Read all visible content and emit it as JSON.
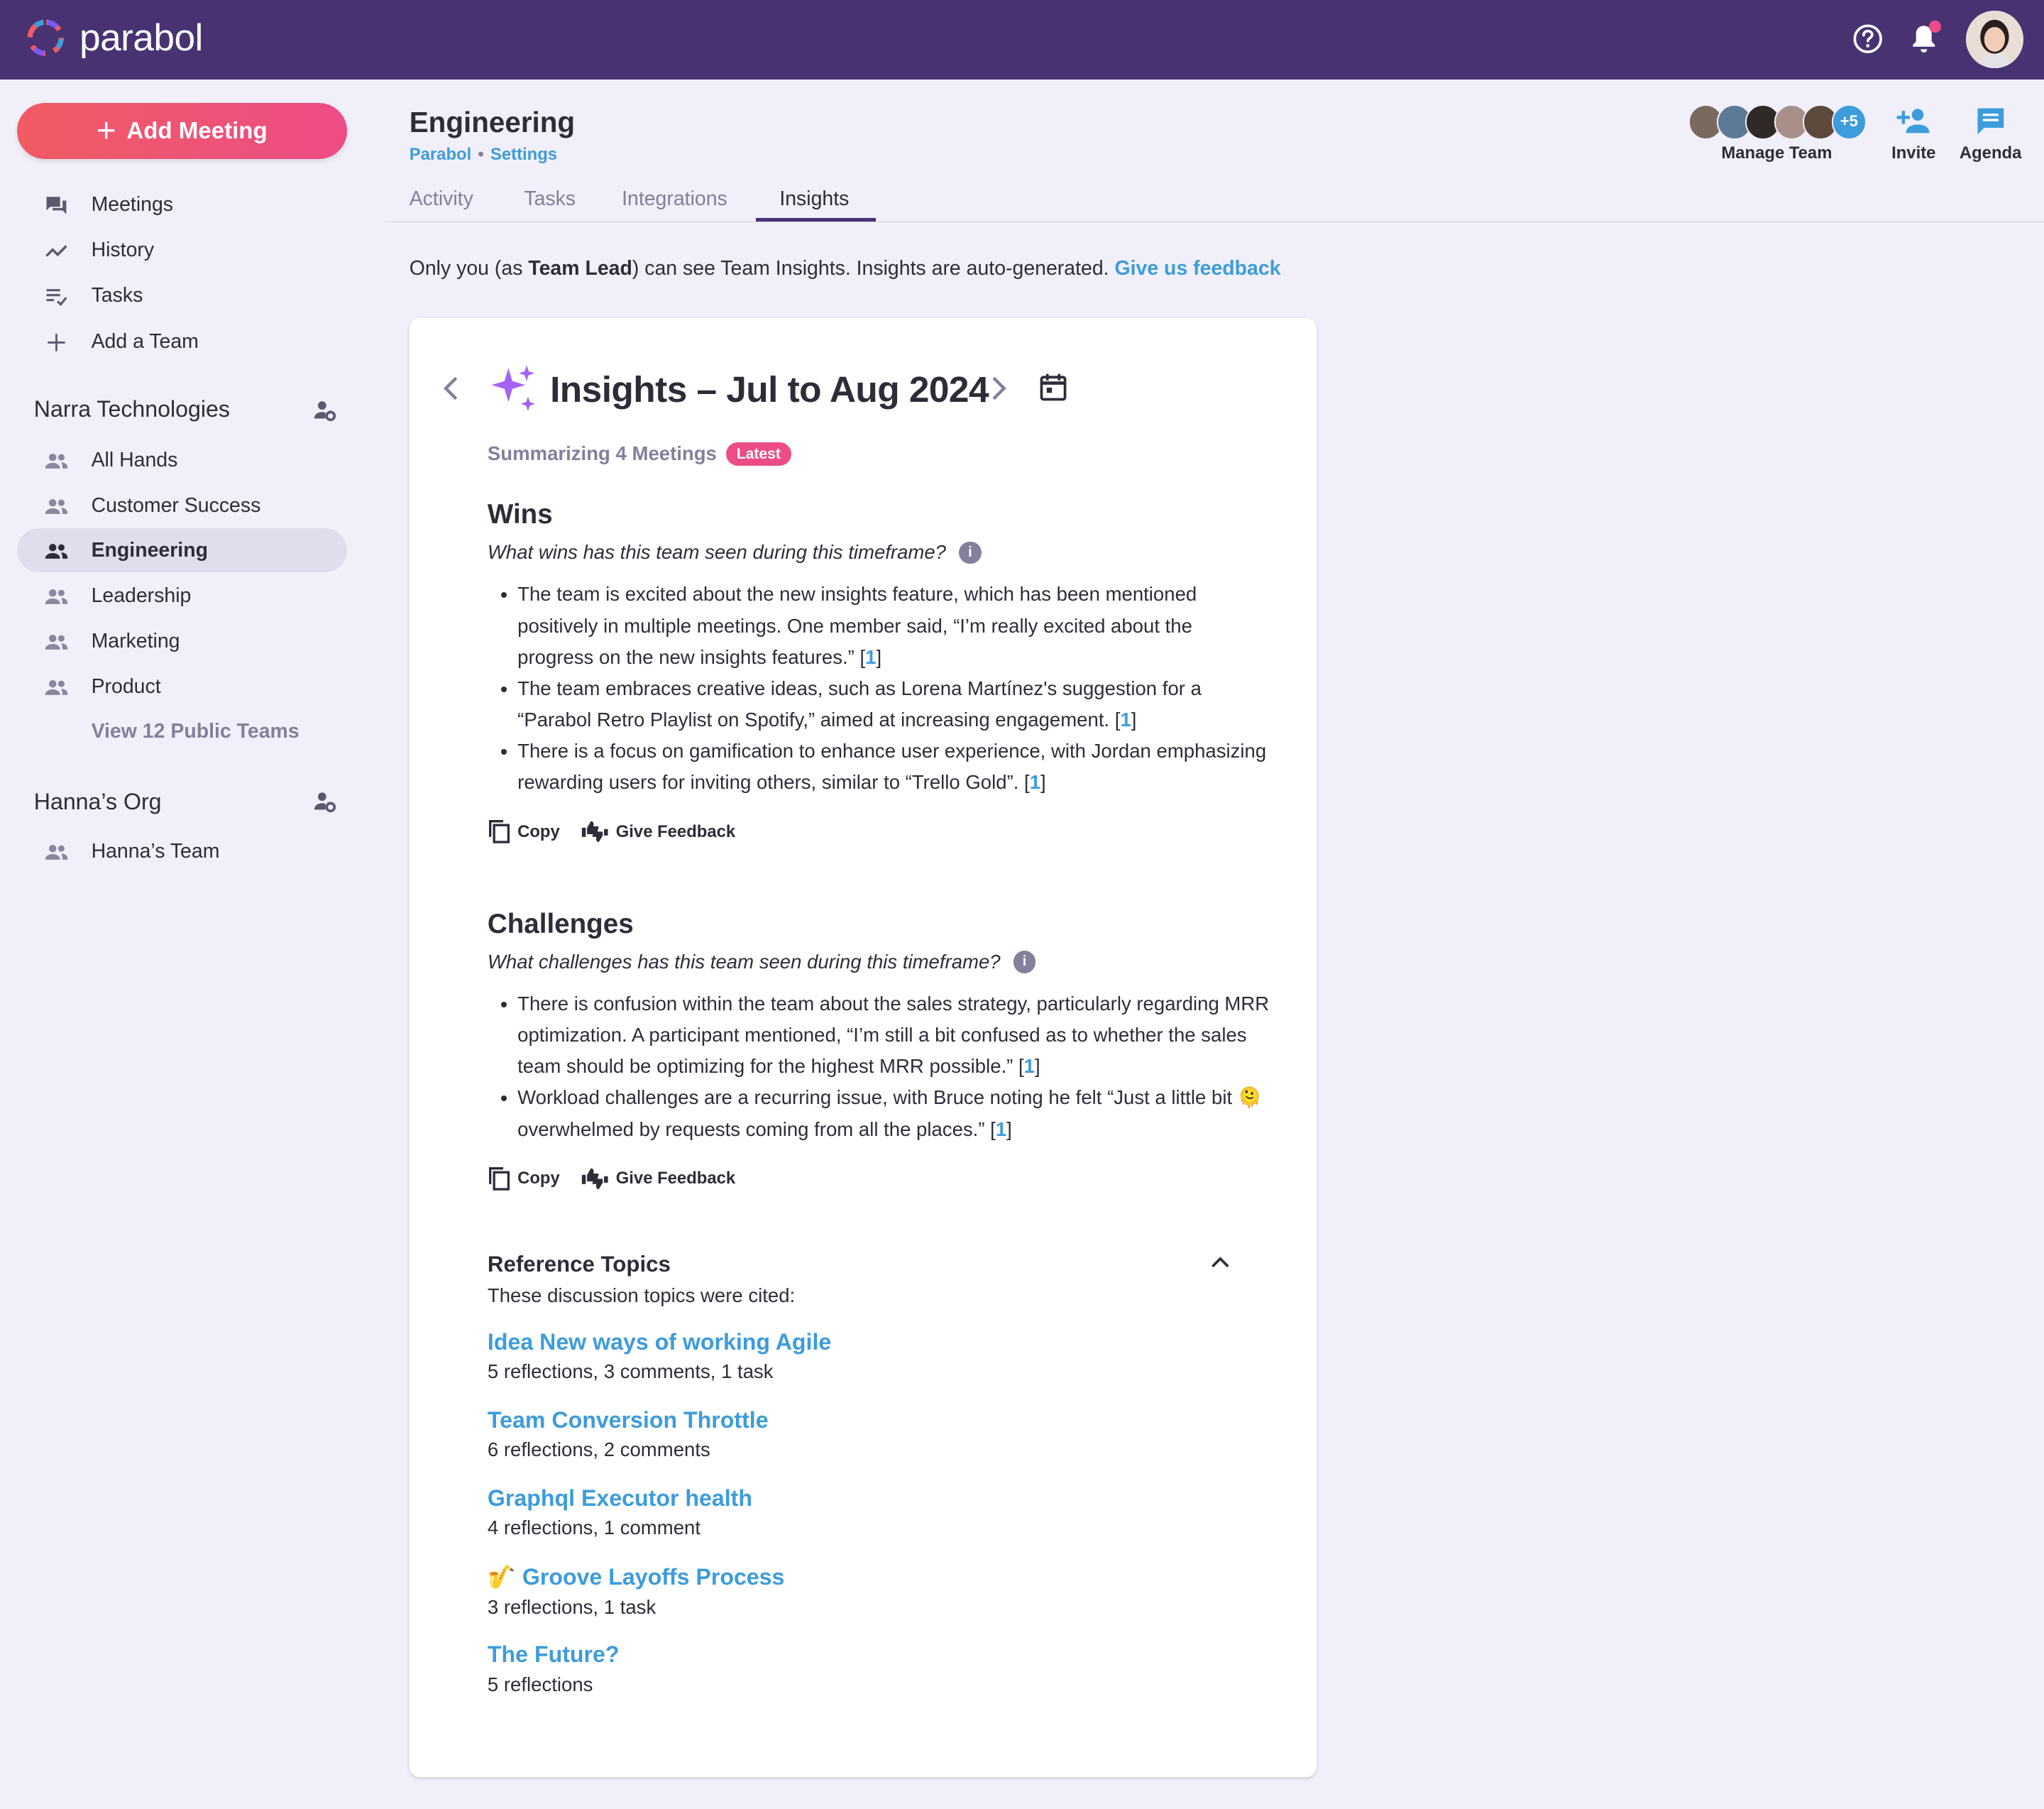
{
  "app": {
    "name": "parabol"
  },
  "sidebar": {
    "add_meeting": "Add Meeting",
    "nav": [
      {
        "label": "Meetings",
        "icon": "forum-icon"
      },
      {
        "label": "History",
        "icon": "timeline-icon"
      },
      {
        "label": "Tasks",
        "icon": "playlist-check-icon"
      },
      {
        "label": "Add a Team",
        "icon": "plus-icon"
      }
    ],
    "orgs": [
      {
        "name": "Narra Technologies",
        "teams": [
          "All Hands",
          "Customer Success",
          "Engineering",
          "Leadership",
          "Marketing",
          "Product"
        ],
        "active_team": "Engineering",
        "view_public": "View 12 Public Teams"
      },
      {
        "name": "Hanna’s Org",
        "teams": [
          "Hanna’s Team"
        ]
      }
    ]
  },
  "header": {
    "team_name": "Engineering",
    "breadcrumb": {
      "org": "Parabol",
      "settings": "Settings"
    },
    "tabs": [
      "Activity",
      "Tasks",
      "Integrations",
      "Insights"
    ],
    "active_tab": "Insights",
    "avatar_overflow": "+5",
    "manage_team": "Manage Team",
    "invite": "Invite",
    "agenda": "Agenda"
  },
  "notice": {
    "prefix": "Only you (as ",
    "role": "Team Lead",
    "suffix": ") can see Team Insights. Insights are auto-generated.",
    "feedback_link": "Give us feedback"
  },
  "insights": {
    "title": "Insights – Jul to Aug 2024",
    "summary": "Summarizing 4 Meetings",
    "badge": "Latest",
    "copy_label": "Copy",
    "feedback_label": "Give Feedback",
    "wins": {
      "title": "Wins",
      "question": "What wins has this team seen during this timeframe?",
      "items": [
        {
          "text": "The team is excited about the new insights feature, which has been mentioned positively in multiple meetings. One member said, “I’m really excited about the progress on the new insights features.”",
          "cite": "1"
        },
        {
          "text": "The team embraces creative ideas, such as Lorena Martínez's suggestion for a “Parabol Retro Playlist on Spotify,” aimed at increasing engagement.",
          "cite": "1"
        },
        {
          "text": "There is a focus on gamification to enhance user experience, with Jordan emphasizing rewarding users for inviting others, similar to “Trello Gold”.",
          "cite": "1"
        }
      ]
    },
    "challenges": {
      "title": "Challenges",
      "question": "What challenges has this team seen during this timeframe?",
      "items": [
        {
          "text": "There is confusion within the team about the sales strategy, particularly regarding MRR optimization. A participant mentioned, “I’m still a bit confused as to whether the sales team should be optimizing for the highest MRR possible.”",
          "cite": "1"
        },
        {
          "text": "Workload challenges are a recurring issue, with Bruce noting he felt “Just a little bit 🫠 overwhelmed by requests coming from all the places.”",
          "cite": "1"
        }
      ]
    },
    "references": {
      "title": "Reference Topics",
      "subtitle": "These discussion topics were cited:",
      "topics": [
        {
          "title": "Idea New ways of working Agile",
          "stats": "5 reflections, 3 comments, 1 task"
        },
        {
          "title": "Team Conversion Throttle",
          "stats": "6 reflections, 2 comments"
        },
        {
          "title": "Graphql Executor health",
          "stats": "4 reflections, 1 comment"
        },
        {
          "title": "🎷 Groove Layoffs Process",
          "stats": "3 reflections, 1 task"
        },
        {
          "title": "The Future?",
          "stats": "5 reflections"
        }
      ]
    }
  },
  "colors": {
    "topbar": "#493272",
    "accent_link": "#3D9CDB",
    "pink": "#ED4C86",
    "background": "#F1F0FA"
  }
}
